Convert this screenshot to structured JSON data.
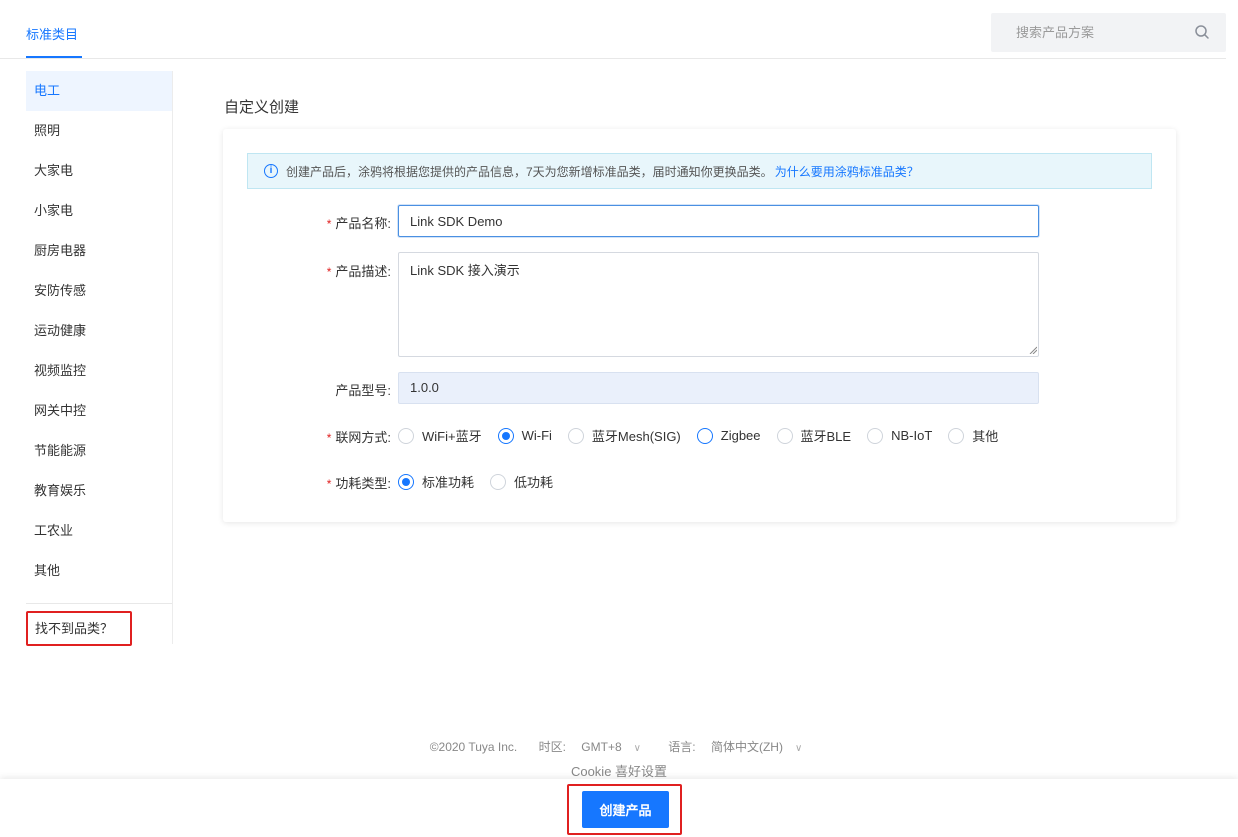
{
  "header": {
    "tab_label": "标准类目",
    "search_placeholder": "搜索产品方案"
  },
  "sidebar": {
    "items": [
      {
        "label": "电工",
        "active": true
      },
      {
        "label": "照明"
      },
      {
        "label": "大家电"
      },
      {
        "label": "小家电"
      },
      {
        "label": "厨房电器"
      },
      {
        "label": "安防传感"
      },
      {
        "label": "运动健康"
      },
      {
        "label": "视频监控"
      },
      {
        "label": "网关中控"
      },
      {
        "label": "节能能源"
      },
      {
        "label": "教育娱乐"
      },
      {
        "label": "工农业"
      },
      {
        "label": "其他"
      }
    ],
    "not_found": "找不到品类？"
  },
  "main": {
    "section_title": "自定义创建",
    "notice_text": "创建产品后，涂鸦将根据您提供的产品信息，7天为您新增标准品类，届时通知你更换品类。",
    "notice_link": "为什么要用涂鸦标准品类？",
    "form": {
      "required_mark": "*",
      "name_label": "产品名称:",
      "name_value": "Link SDK Demo",
      "desc_label": "产品描述:",
      "desc_value": "Link SDK 接入演示",
      "model_label": "产品型号:",
      "model_value": "1.0.0",
      "network_label": "联网方式:",
      "network_options": [
        "WiFi+蓝牙",
        "Wi-Fi",
        "蓝牙Mesh(SIG)",
        "Zigbee",
        "蓝牙BLE",
        "NB-IoT",
        "其他"
      ],
      "network_selected": "Wi-Fi",
      "power_label": "功耗类型:",
      "power_options": [
        "标准功耗",
        "低功耗"
      ],
      "power_selected": "标准功耗"
    }
  },
  "footer": {
    "copyright": "©2020 Tuya Inc.",
    "timezone_label": "时区:",
    "timezone_value": "GMT+8",
    "language_label": "语言:",
    "language_value": "简体中文(ZH)",
    "cookie": "Cookie 喜好设置"
  },
  "actions": {
    "create_button": "创建产品"
  },
  "colors": {
    "accent": "#1677ff",
    "highlight_box": "#e02020"
  }
}
